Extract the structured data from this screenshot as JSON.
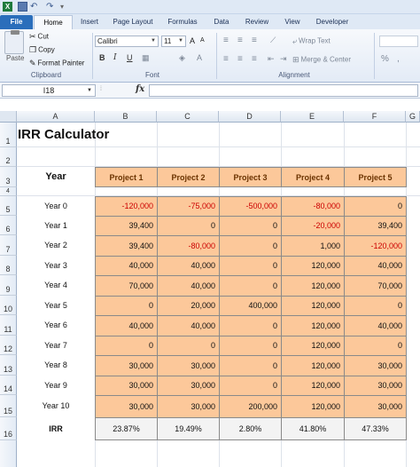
{
  "quick_access": {
    "excel_glyph": "X",
    "undo_glyph": "↶",
    "redo_glyph": "↷",
    "sep_glyph": "▾"
  },
  "tabs": [
    "File",
    "Home",
    "Insert",
    "Page Layout",
    "Formulas",
    "Data",
    "Review",
    "View",
    "Developer"
  ],
  "ribbon": {
    "clipboard": {
      "paste": "Paste",
      "cut": "Cut",
      "copy": "Copy",
      "format_painter": "Format Painter",
      "label": "Clipboard"
    },
    "font": {
      "name": "Calibri",
      "size": "11",
      "grow": "A",
      "shrink": "A",
      "bold": "B",
      "italic": "I",
      "underline": "U",
      "label": "Font"
    },
    "alignment": {
      "wrap_text": "Wrap Text",
      "merge_center": "Merge & Center",
      "label": "Alignment"
    },
    "number": {
      "percent": "%",
      "comma": ","
    }
  },
  "formula_bar": {
    "name_box": "I18",
    "fx": "fx",
    "dots": "⁞",
    "formula": ""
  },
  "columns": [
    "A",
    "B",
    "C",
    "D",
    "E",
    "F",
    "G"
  ],
  "rows": [
    "1",
    "2",
    "3",
    "4",
    "5",
    "6",
    "7",
    "8",
    "9",
    "10",
    "11",
    "12",
    "13",
    "14",
    "15",
    "16"
  ],
  "sheet": {
    "title": "IRR Calculator",
    "year_header": "Year",
    "projects": [
      "Project 1",
      "Project 2",
      "Project 3",
      "Project 4",
      "Project 5"
    ],
    "years": [
      "Year 0",
      "Year 1",
      "Year 2",
      "Year 3",
      "Year 4",
      "Year 5",
      "Year 6",
      "Year 7",
      "Year 8",
      "Year 9",
      "Year 10"
    ],
    "values": [
      [
        "-120,000",
        "-75,000",
        "-500,000",
        "-80,000",
        "0"
      ],
      [
        "39,400",
        "0",
        "0",
        "-20,000",
        "39,400"
      ],
      [
        "39,400",
        "-80,000",
        "0",
        "1,000",
        "-120,000"
      ],
      [
        "40,000",
        "40,000",
        "0",
        "120,000",
        "40,000"
      ],
      [
        "70,000",
        "40,000",
        "0",
        "120,000",
        "70,000"
      ],
      [
        "0",
        "20,000",
        "400,000",
        "120,000",
        "0"
      ],
      [
        "40,000",
        "40,000",
        "0",
        "120,000",
        "40,000"
      ],
      [
        "0",
        "0",
        "0",
        "120,000",
        "0"
      ],
      [
        "30,000",
        "30,000",
        "0",
        "120,000",
        "30,000"
      ],
      [
        "30,000",
        "30,000",
        "0",
        "120,000",
        "30,000"
      ],
      [
        "30,000",
        "30,000",
        "200,000",
        "120,000",
        "30,000"
      ]
    ],
    "irr_label": "IRR",
    "irr_values": [
      "23.87%",
      "19.49%",
      "2.80%",
      "41.80%",
      "47.33%"
    ]
  }
}
